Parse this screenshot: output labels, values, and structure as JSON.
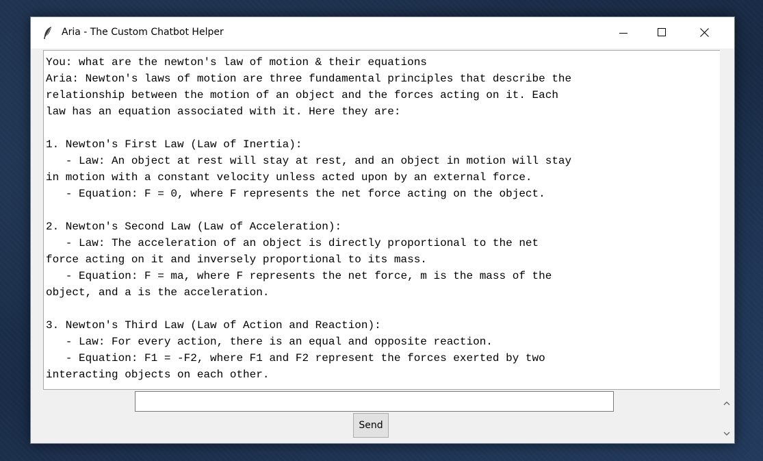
{
  "window": {
    "title": "Aria - The Custom Chatbot Helper"
  },
  "chat": {
    "lines": [
      "You: what are the newton's law of motion & their equations",
      "Aria: Newton's laws of motion are three fundamental principles that describe the",
      "relationship between the motion of an object and the forces acting on it. Each",
      "law has an equation associated with it. Here they are:",
      "",
      "1. Newton's First Law (Law of Inertia):",
      "   - Law: An object at rest will stay at rest, and an object in motion will stay",
      "in motion with a constant velocity unless acted upon by an external force.",
      "   - Equation: F = 0, where F represents the net force acting on the object.",
      "",
      "2. Newton's Second Law (Law of Acceleration):",
      "   - Law: The acceleration of an object is directly proportional to the net",
      "force acting on it and inversely proportional to its mass.",
      "   - Equation: F = ma, where F represents the net force, m is the mass of the",
      "object, and a is the acceleration.",
      "",
      "3. Newton's Third Law (Law of Action and Reaction):",
      "   - Law: For every action, there is an equal and opposite reaction.",
      "   - Equation: F1 = -F2, where F1 and F2 represent the forces exerted by two",
      "interacting objects on each other."
    ]
  },
  "input": {
    "value": ""
  },
  "send_button": {
    "label": "Send"
  },
  "icons": {
    "app": "feather-icon",
    "minimize": "minimize-icon",
    "maximize": "maximize-icon",
    "close": "close-icon",
    "scroll_up": "chevron-up-icon",
    "scroll_down": "chevron-down-icon"
  }
}
